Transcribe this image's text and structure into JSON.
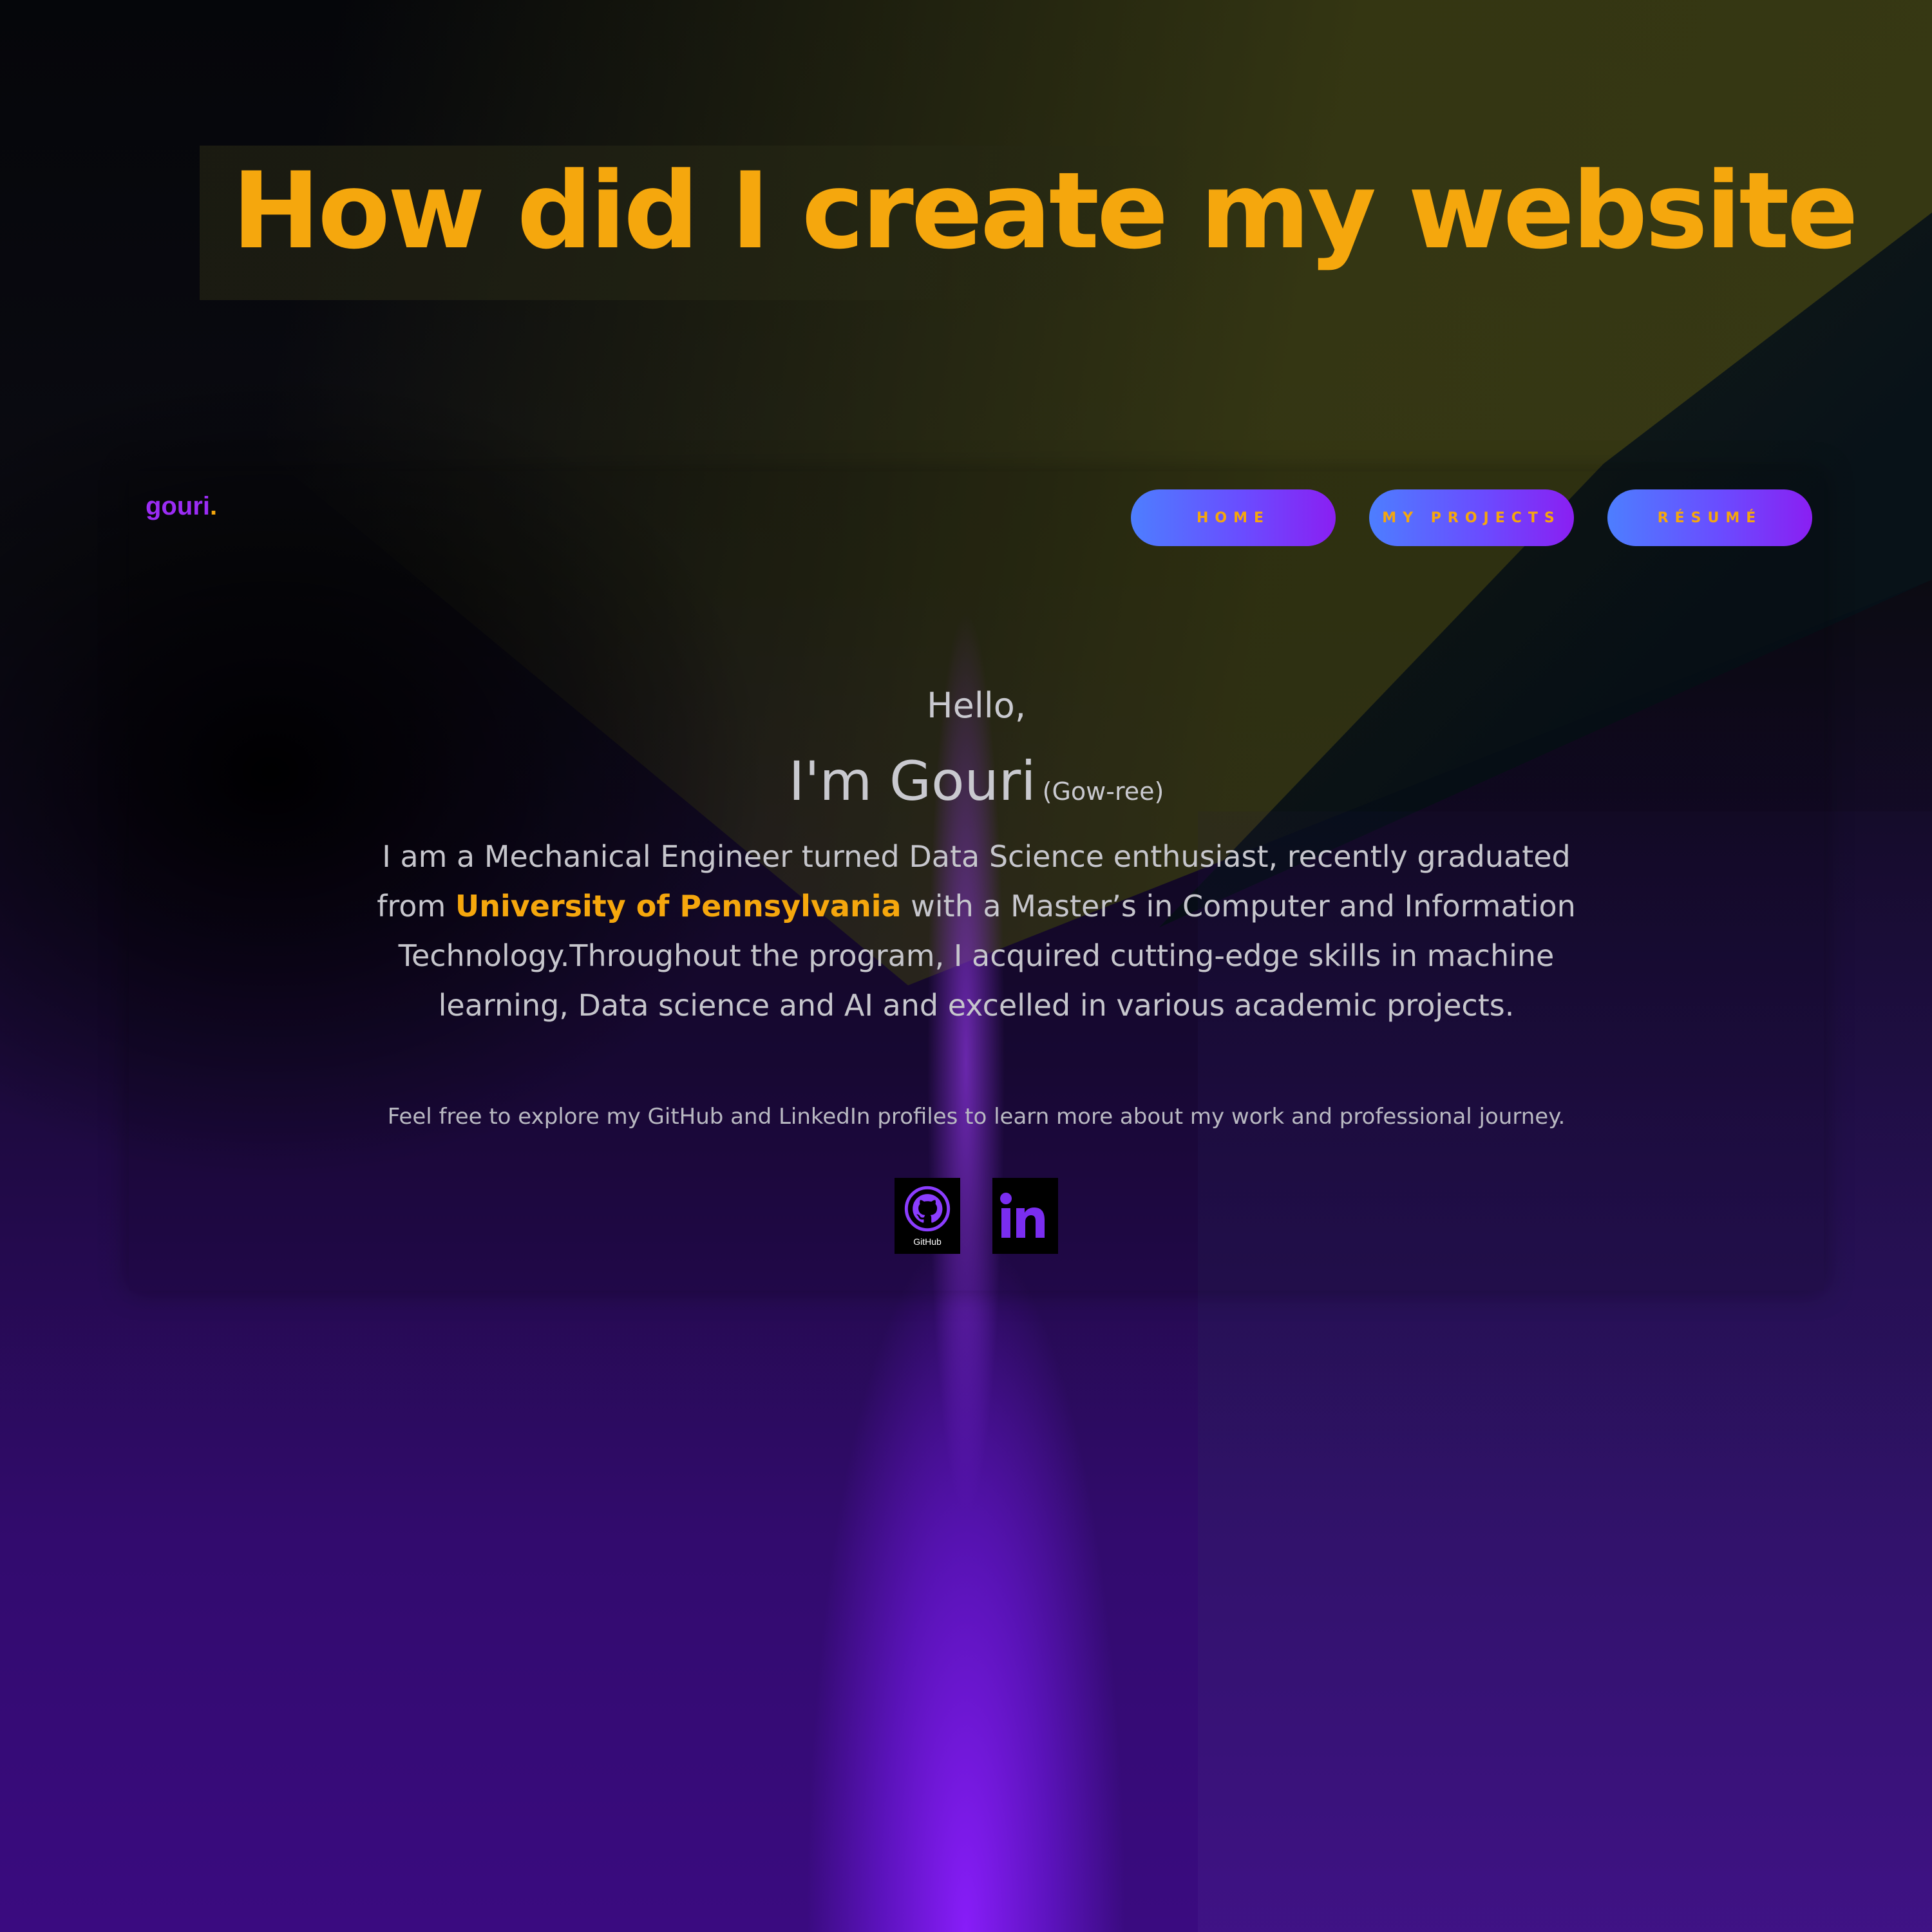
{
  "page": {
    "title": "How did I create my website"
  },
  "site": {
    "logo": {
      "text": "gouri",
      "dot": "."
    },
    "nav": [
      {
        "label": "HOME"
      },
      {
        "label": "MY PROJECTS"
      },
      {
        "label": "RÉSUMÉ"
      }
    ],
    "hero": {
      "greeting": "Hello,",
      "name": "I'm Gouri",
      "pronunciation": "(Gow-ree)",
      "bio_part1": "I am a Mechanical Engineer turned Data Science enthusiast, recently graduated from",
      "university": "University of Pennsylvania",
      "bio_part2": "with a Master’s in Computer and Information Technology.Throughout the program, I acquired cutting-edge skills in machine learning, Data science and AI and excelled in various academic projects.",
      "explore": "Feel free to explore my GitHub and LinkedIn profiles to learn more about my work and professional journey."
    },
    "socials": [
      {
        "icon": "github-icon",
        "label": "GitHub"
      },
      {
        "icon": "linkedin-icon",
        "label": "in"
      }
    ]
  },
  "colors": {
    "accent": "#f5a70d",
    "logo_purple": "#9b2cf5",
    "button_gradient_start": "#4d7eff",
    "button_gradient_end": "#8a1ff2"
  }
}
